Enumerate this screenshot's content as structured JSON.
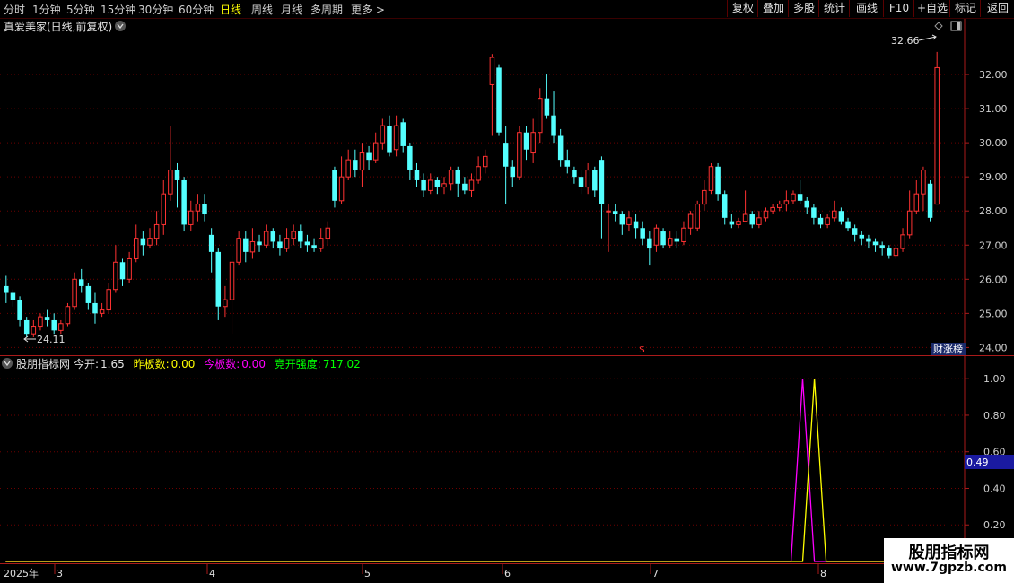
{
  "toolbar": {
    "periods": [
      "分时",
      "1分钟",
      "5分钟",
      "15分钟",
      "30分钟",
      "60分钟",
      "日线",
      "周线",
      "月线",
      "多周期",
      "更多"
    ],
    "active_period": "日线",
    "more_arrow": ">",
    "buttons": [
      "复权",
      "叠加",
      "多股",
      "统计",
      "画线",
      "F10",
      "+自选",
      "标记",
      "返回"
    ]
  },
  "main_chart": {
    "title": "真爱美家(日线,前复权)",
    "high_label": "32.66",
    "low_label": "24.11",
    "event_marker": "$",
    "badge": "财涨榜",
    "colors": {
      "up": "#ff3232",
      "down": "#54ffff",
      "grid": "#6e0000",
      "axis": "#aa1a1a"
    }
  },
  "indicator": {
    "name": "股朋指标网",
    "items": [
      {
        "label": "今开:",
        "value": "1.65",
        "color": "#e0e0e0"
      },
      {
        "label": "昨板数:",
        "value": "0.00",
        "color": "#ffff00"
      },
      {
        "label": "今板数:",
        "value": "0.00",
        "color": "#ff00ff"
      },
      {
        "label": "竞开强度:",
        "value": "717.02",
        "color": "#00ff00"
      }
    ],
    "cursor_value": "0.49",
    "y_ticks": [
      "1.00",
      "0.80",
      "0.60",
      "0.40",
      "0.20"
    ]
  },
  "time_axis": {
    "year": "2025年",
    "months": [
      "3",
      "4",
      "5",
      "6",
      "7",
      "8"
    ]
  },
  "watermark": {
    "title": "股朋指标网",
    "url": "www.7gpzb.com"
  },
  "chart_data": [
    {
      "type": "candlestick",
      "title": "真爱美家(日线,前复权)",
      "ylim": [
        23.8,
        33.0
      ],
      "y_ticks": [
        24.0,
        25.0,
        26.0,
        27.0,
        28.0,
        29.0,
        30.0,
        31.0,
        32.0
      ],
      "candles": [
        [
          25.8,
          25.6,
          26.1,
          25.3
        ],
        [
          25.6,
          25.4,
          25.7,
          25.2
        ],
        [
          25.4,
          24.8,
          25.5,
          24.6
        ],
        [
          24.8,
          24.4,
          24.9,
          24.3
        ],
        [
          24.4,
          24.6,
          24.8,
          24.3
        ],
        [
          24.6,
          24.9,
          25.0,
          24.5
        ],
        [
          24.9,
          24.8,
          25.1,
          24.6
        ],
        [
          24.8,
          24.5,
          25.0,
          24.4
        ],
        [
          24.5,
          24.7,
          24.8,
          24.4
        ],
        [
          24.7,
          25.2,
          25.3,
          24.6
        ],
        [
          25.2,
          26.0,
          26.2,
          25.1
        ],
        [
          26.0,
          25.8,
          26.3,
          25.6
        ],
        [
          25.8,
          25.3,
          25.9,
          25.1
        ],
        [
          25.3,
          25.0,
          25.6,
          24.7
        ],
        [
          25.0,
          25.1,
          25.3,
          24.9
        ],
        [
          25.1,
          25.7,
          25.9,
          25.0
        ],
        [
          25.7,
          26.5,
          27.0,
          25.6
        ],
        [
          26.5,
          26.0,
          26.6,
          25.8
        ],
        [
          26.0,
          26.6,
          26.8,
          25.9
        ],
        [
          26.6,
          27.2,
          27.6,
          26.5
        ],
        [
          27.2,
          27.0,
          27.4,
          26.7
        ],
        [
          27.0,
          27.2,
          27.5,
          26.9
        ],
        [
          27.2,
          27.6,
          28.0,
          27.0
        ],
        [
          27.6,
          28.5,
          28.9,
          27.3
        ],
        [
          28.5,
          29.2,
          30.5,
          28.3
        ],
        [
          29.2,
          28.9,
          29.4,
          28.1
        ],
        [
          28.9,
          27.6,
          29.0,
          27.4
        ],
        [
          27.6,
          28.0,
          28.3,
          27.4
        ],
        [
          28.0,
          28.2,
          28.5,
          27.7
        ],
        [
          28.2,
          27.9,
          28.5,
          27.7
        ],
        [
          27.3,
          26.8,
          27.5,
          26.2
        ],
        [
          26.8,
          25.2,
          26.9,
          24.8
        ],
        [
          25.2,
          25.4,
          25.8,
          24.9
        ],
        [
          25.4,
          26.5,
          26.7,
          24.4
        ],
        [
          26.5,
          27.2,
          27.4,
          26.4
        ],
        [
          27.2,
          26.8,
          27.4,
          26.5
        ],
        [
          26.8,
          27.1,
          27.5,
          26.6
        ],
        [
          27.1,
          27.0,
          27.3,
          26.8
        ],
        [
          27.0,
          27.4,
          27.6,
          26.9
        ],
        [
          27.4,
          27.1,
          27.5,
          26.9
        ],
        [
          27.1,
          26.9,
          27.3,
          26.7
        ],
        [
          26.9,
          27.2,
          27.5,
          26.8
        ],
        [
          27.2,
          27.4,
          27.6,
          27.0
        ],
        [
          27.4,
          27.1,
          27.6,
          26.9
        ],
        [
          27.1,
          27.0,
          27.3,
          26.8
        ],
        [
          27.0,
          26.9,
          27.2,
          26.8
        ],
        [
          26.9,
          27.2,
          27.5,
          26.8
        ],
        [
          27.2,
          27.5,
          27.7,
          27.0
        ],
        [
          29.2,
          28.3,
          29.3,
          28.1
        ],
        [
          28.3,
          29.0,
          29.6,
          28.2
        ],
        [
          29.0,
          29.5,
          29.8,
          28.9
        ],
        [
          29.5,
          29.2,
          29.8,
          29.0
        ],
        [
          29.2,
          29.7,
          30.0,
          28.7
        ],
        [
          29.7,
          29.5,
          29.9,
          29.2
        ],
        [
          29.5,
          30.0,
          30.3,
          29.4
        ],
        [
          30.0,
          30.5,
          30.7,
          29.8
        ],
        [
          30.5,
          29.7,
          30.8,
          29.6
        ],
        [
          29.8,
          30.5,
          30.8,
          29.6
        ],
        [
          30.6,
          29.9,
          30.7,
          29.7
        ],
        [
          29.9,
          29.2,
          30.0,
          28.9
        ],
        [
          29.2,
          28.9,
          29.4,
          28.7
        ],
        [
          28.9,
          28.6,
          29.1,
          28.4
        ],
        [
          28.6,
          28.9,
          29.1,
          28.5
        ],
        [
          28.9,
          28.7,
          29.0,
          28.5
        ],
        [
          28.7,
          28.8,
          29.0,
          28.5
        ],
        [
          28.8,
          29.2,
          29.3,
          28.6
        ],
        [
          29.2,
          28.8,
          29.3,
          28.4
        ],
        [
          28.8,
          28.6,
          29.0,
          28.5
        ],
        [
          28.6,
          28.9,
          29.1,
          28.4
        ],
        [
          28.9,
          29.3,
          29.6,
          28.8
        ],
        [
          29.3,
          29.6,
          29.8,
          29.1
        ],
        [
          31.7,
          32.5,
          32.6,
          30.2
        ],
        [
          32.2,
          30.3,
          32.3,
          30.2
        ],
        [
          30.0,
          29.3,
          30.5,
          28.2
        ],
        [
          29.3,
          29.0,
          29.5,
          28.7
        ],
        [
          29.0,
          30.3,
          30.5,
          28.9
        ],
        [
          30.3,
          29.8,
          30.5,
          29.5
        ],
        [
          29.7,
          30.3,
          30.7,
          29.4
        ],
        [
          30.3,
          31.3,
          31.6,
          30.0
        ],
        [
          31.3,
          30.8,
          32.0,
          30.7
        ],
        [
          30.8,
          30.2,
          31.5,
          30.0
        ],
        [
          30.2,
          29.5,
          30.4,
          29.3
        ],
        [
          29.5,
          29.3,
          29.8,
          29.1
        ],
        [
          29.2,
          29.0,
          29.3,
          28.8
        ],
        [
          29.0,
          28.7,
          29.2,
          28.5
        ],
        [
          28.7,
          29.2,
          29.4,
          28.5
        ],
        [
          29.2,
          28.6,
          29.3,
          28.4
        ],
        [
          29.5,
          28.2,
          29.6,
          27.2
        ],
        [
          28.0,
          28.0,
          28.2,
          26.8
        ],
        [
          28.0,
          27.9,
          28.2,
          27.7
        ],
        [
          27.9,
          27.6,
          28.0,
          27.3
        ],
        [
          27.6,
          27.8,
          28.0,
          27.4
        ],
        [
          27.7,
          27.5,
          27.9,
          27.2
        ],
        [
          27.5,
          27.2,
          27.7,
          27.0
        ],
        [
          27.2,
          26.9,
          27.4,
          26.4
        ],
        [
          27.0,
          27.5,
          27.6,
          26.8
        ],
        [
          27.4,
          27.0,
          27.5,
          26.9
        ],
        [
          27.0,
          27.2,
          27.4,
          26.9
        ],
        [
          27.2,
          27.1,
          27.4,
          26.9
        ],
        [
          27.1,
          27.5,
          27.7,
          27.0
        ],
        [
          27.5,
          27.9,
          28.0,
          27.3
        ],
        [
          27.5,
          28.2,
          28.3,
          27.4
        ],
        [
          28.2,
          28.6,
          28.9,
          28.0
        ],
        [
          28.6,
          29.3,
          29.4,
          28.5
        ],
        [
          29.3,
          28.5,
          29.4,
          28.3
        ],
        [
          28.5,
          27.8,
          28.6,
          27.6
        ],
        [
          27.7,
          27.6,
          27.9,
          27.5
        ],
        [
          27.6,
          27.7,
          27.8,
          27.5
        ],
        [
          27.7,
          27.9,
          28.6,
          27.7
        ],
        [
          27.9,
          27.6,
          28.0,
          27.5
        ],
        [
          27.6,
          27.8,
          28.0,
          27.5
        ],
        [
          27.8,
          28.0,
          28.1,
          27.7
        ],
        [
          28.0,
          28.1,
          28.2,
          27.9
        ],
        [
          28.1,
          28.2,
          28.3,
          28.0
        ],
        [
          28.2,
          28.3,
          28.6,
          28.0
        ],
        [
          28.3,
          28.5,
          28.6,
          28.2
        ],
        [
          28.5,
          28.3,
          28.9,
          28.2
        ],
        [
          28.3,
          28.1,
          28.4,
          27.9
        ],
        [
          28.1,
          27.8,
          28.2,
          27.6
        ],
        [
          27.8,
          27.6,
          27.9,
          27.5
        ],
        [
          27.6,
          27.8,
          27.9,
          27.5
        ],
        [
          27.8,
          28.0,
          28.3,
          27.7
        ],
        [
          28.0,
          27.7,
          28.1,
          27.6
        ],
        [
          27.7,
          27.5,
          27.8,
          27.4
        ],
        [
          27.5,
          27.3,
          27.6,
          27.1
        ],
        [
          27.3,
          27.2,
          27.4,
          27.0
        ],
        [
          27.2,
          27.1,
          27.3,
          26.9
        ],
        [
          27.1,
          27.0,
          27.2,
          26.8
        ],
        [
          27.0,
          26.9,
          27.1,
          26.7
        ],
        [
          26.9,
          26.7,
          27.0,
          26.6
        ],
        [
          26.7,
          26.9,
          27.0,
          26.6
        ],
        [
          26.9,
          27.3,
          27.5,
          26.8
        ],
        [
          27.3,
          28.0,
          28.6,
          27.2
        ],
        [
          28.0,
          28.5,
          28.9,
          27.9
        ],
        [
          28.5,
          29.2,
          29.3,
          28.0
        ],
        [
          28.8,
          27.8,
          28.9,
          27.7
        ],
        [
          28.2,
          32.2,
          32.66,
          28.2
        ]
      ]
    },
    {
      "type": "line",
      "title": "股朋指标网",
      "ylim": [
        0.0,
        1.05
      ],
      "y_ticks": [
        0.2,
        0.4,
        0.6,
        0.8,
        1.0
      ],
      "x_range": [
        0,
        159
      ],
      "series": [
        {
          "name": "今板数",
          "color": "#ff00ff",
          "points": [
            [
              0,
              0
            ],
            [
              134,
              0
            ],
            [
              136,
              1.0
            ],
            [
              138,
              0
            ],
            [
              159,
              0
            ]
          ]
        },
        {
          "name": "昨板数",
          "color": "#ffff00",
          "points": [
            [
              0,
              0
            ],
            [
              136,
              0
            ],
            [
              138,
              1.0
            ],
            [
              140,
              0
            ],
            [
              159,
              0
            ]
          ]
        }
      ]
    }
  ]
}
